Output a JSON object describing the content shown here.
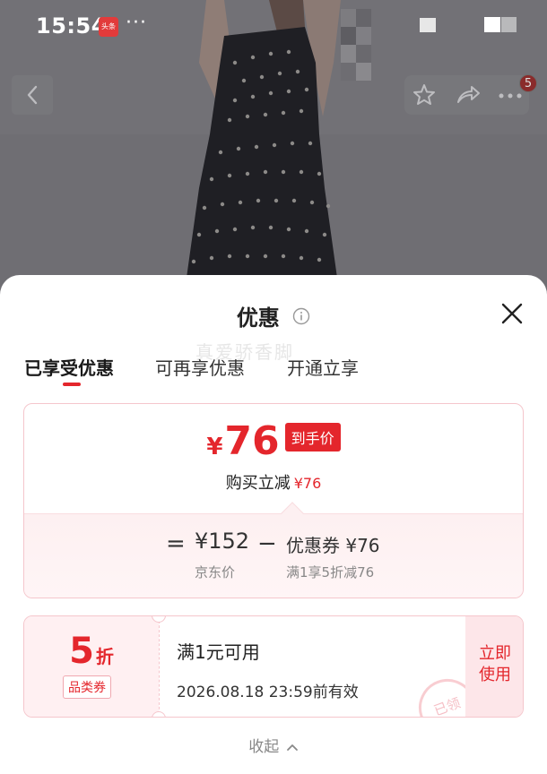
{
  "status_bar": {
    "time": "15:54",
    "app_badge": "头条",
    "more": "···"
  },
  "nav": {
    "cart_badge": "5"
  },
  "sheet": {
    "title": "优惠",
    "tabs": [
      {
        "label": "已享受优惠",
        "active": true
      },
      {
        "label": "可再享优惠",
        "active": false
      },
      {
        "label": "开通立享",
        "active": false
      }
    ],
    "watermark": "真爱骄香脚"
  },
  "price_card": {
    "currency": "¥",
    "final_price": "76",
    "final_tag": "到手价",
    "instant_reduce_label": "购买立减",
    "instant_reduce_value": "¥76",
    "equals": "=",
    "minus": "−",
    "jd_price": "¥152",
    "jd_price_label": "京东价",
    "coupon_amount": "优惠券 ¥76",
    "coupon_desc": "满1享5折减76"
  },
  "coupon": {
    "discount_number": "5",
    "discount_unit": "折",
    "type": "品类券",
    "condition": "满1元可用",
    "validity": "2026.08.18 23:59前有效",
    "use_button": "立即使用",
    "stamp": "已领"
  },
  "collapse_label": "收起",
  "colors": {
    "accent": "#e4262c",
    "card_border": "#f5c6cc",
    "card_bg_light": "#fdf0f1"
  }
}
